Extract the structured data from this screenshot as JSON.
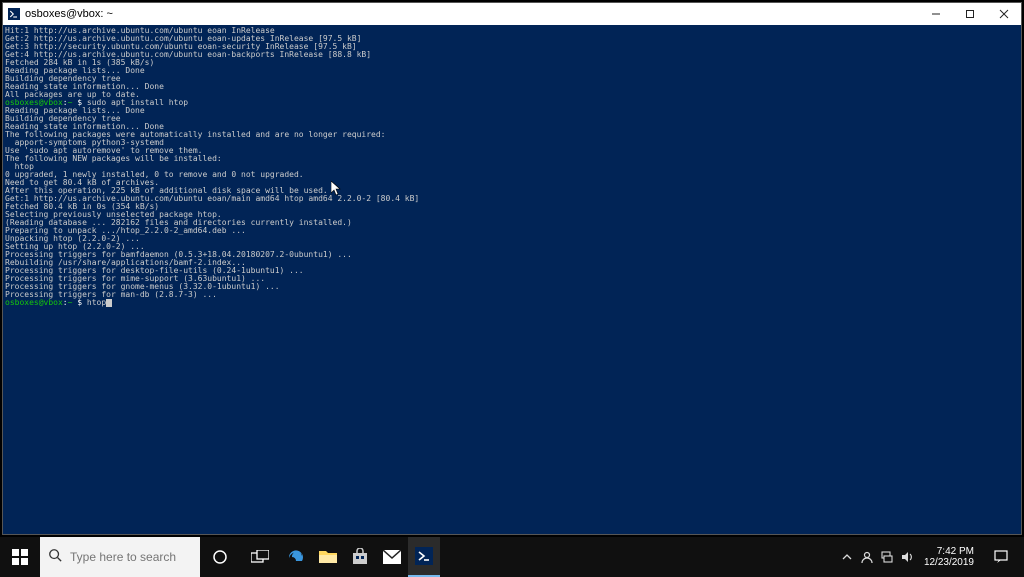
{
  "window": {
    "title": "osboxes@vbox: ~"
  },
  "prompt": {
    "user": "osboxes",
    "host": "vbox",
    "path": "~",
    "symbol": "$"
  },
  "cmds": {
    "install": "sudo apt install htop",
    "current": "htop"
  },
  "terminal_lines": [
    "Hit:1 http://us.archive.ubuntu.com/ubuntu eoan InRelease",
    "Get:2 http://us.archive.ubuntu.com/ubuntu eoan-updates InRelease [97.5 kB]",
    "Get:3 http://security.ubuntu.com/ubuntu eoan-security InRelease [97.5 kB]",
    "Get:4 http://us.archive.ubuntu.com/ubuntu eoan-backports InRelease [88.8 kB]",
    "Fetched 284 kB in 1s (385 kB/s)",
    "Reading package lists... Done",
    "Building dependency tree",
    "Reading state information... Done",
    "All packages are up to date."
  ],
  "terminal_lines2": [
    "Reading package lists... Done",
    "Building dependency tree",
    "Reading state information... Done",
    "The following packages were automatically installed and are no longer required:",
    "  apport-symptoms python3-systemd",
    "Use 'sudo apt autoremove' to remove them.",
    "The following NEW packages will be installed:",
    "  htop",
    "0 upgraded, 1 newly installed, 0 to remove and 0 not upgraded.",
    "Need to get 80.4 kB of archives.",
    "After this operation, 225 kB of additional disk space will be used.",
    "Get:1 http://us.archive.ubuntu.com/ubuntu eoan/main amd64 htop amd64 2.2.0-2 [80.4 kB]",
    "Fetched 80.4 kB in 0s (354 kB/s)",
    "Selecting previously unselected package htop.",
    "(Reading database ... 282162 files and directories currently installed.)",
    "Preparing to unpack .../htop_2.2.0-2_amd64.deb ...",
    "Unpacking htop (2.2.0-2) ...",
    "Setting up htop (2.2.0-2) ...",
    "Processing triggers for bamfdaemon (0.5.3+18.04.20180207.2-0ubuntu1) ...",
    "Rebuilding /usr/share/applications/bamf-2.index...",
    "Processing triggers for desktop-file-utils (0.24-1ubuntu1) ...",
    "Processing triggers for mime-support (3.63ubuntu1) ...",
    "Processing triggers for gnome-menus (3.32.0-1ubuntu1) ...",
    "Processing triggers for man-db (2.8.7-3) ..."
  ],
  "taskbar": {
    "search_placeholder": "Type here to search"
  },
  "tray": {
    "time": "7:42 PM",
    "date": "12/23/2019"
  }
}
